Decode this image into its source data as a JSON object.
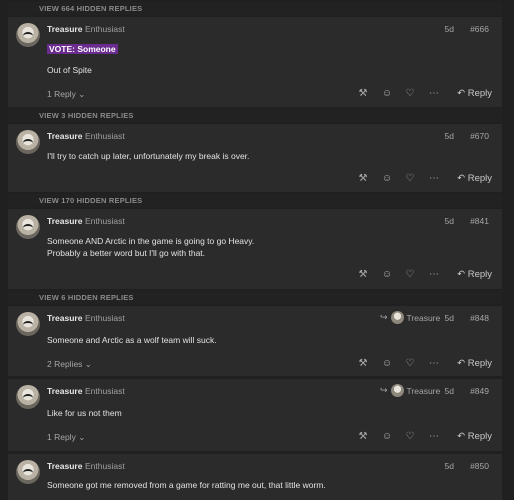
{
  "hidden_bars": [
    "VIEW 664 HIDDEN REPLIES",
    "VIEW 3 HIDDEN REPLIES",
    "VIEW 170 HIDDEN REPLIES",
    "VIEW 6 HIDDEN REPLIES"
  ],
  "posts": [
    {
      "username": "Treasure",
      "title": "Enthusiast",
      "date": "5d",
      "number": "#666",
      "vote_badge": "VOTE: Someone",
      "lines": [
        "Out of Spite"
      ],
      "replies": "1 Reply",
      "reply_label": "Reply"
    },
    {
      "username": "Treasure",
      "title": "Enthusiast",
      "date": "5d",
      "number": "#670",
      "lines": [
        "I'll try to catch up later, unfortunately my break is over."
      ],
      "reply_label": "Reply"
    },
    {
      "username": "Treasure",
      "title": "Enthusiast",
      "date": "5d",
      "number": "#841",
      "lines": [
        "Someone AND Arctic in the game is going to go Heavy.",
        "Probably a better word but I'll go with that."
      ],
      "reply_label": "Reply"
    },
    {
      "username": "Treasure",
      "title": "Enthusiast",
      "date": "5d",
      "number": "#848",
      "reply_to": "Treasure",
      "lines": [
        "Someone and Arctic as a wolf team will suck."
      ],
      "replies": "2 Replies",
      "reply_label": "Reply"
    },
    {
      "username": "Treasure",
      "title": "Enthusiast",
      "date": "5d",
      "number": "#849",
      "reply_to": "Treasure",
      "lines": [
        "Like for us not them"
      ],
      "replies": "1 Reply",
      "reply_label": "Reply"
    },
    {
      "username": "Treasure",
      "title": "Enthusiast",
      "date": "5d",
      "number": "#850",
      "lines": [
        "Someone got me removed from a game for ratting me out, that little worm."
      ]
    }
  ],
  "icons": {
    "pin": "hammer-icon",
    "group": "users-icon",
    "like": "heart-icon",
    "more": "ellipsis-icon",
    "reply": "reply-arrow-icon"
  },
  "colors": {
    "page_bg": "#202020",
    "post_bg": "#2b2b2b",
    "vote_badge": "#6a2d8f"
  }
}
